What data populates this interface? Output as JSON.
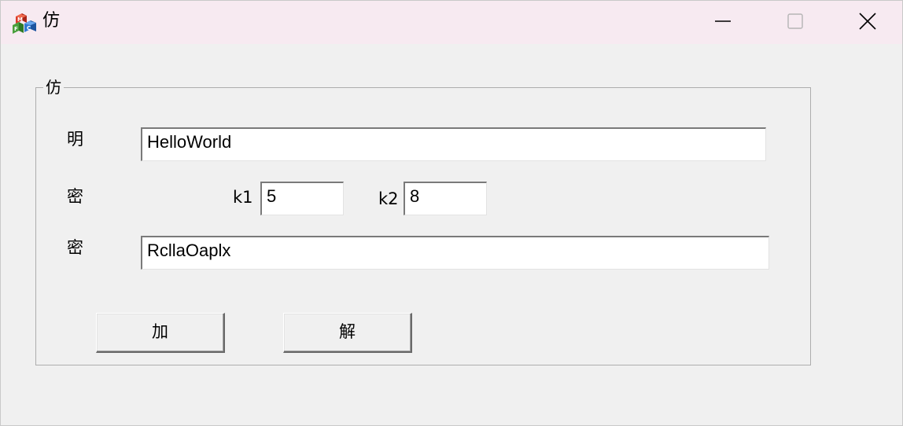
{
  "window": {
    "title": "仿",
    "app_icon": "mfc-app-icon",
    "controls": {
      "minimize_icon": "minimize-icon",
      "maximize_icon": "maximize-icon",
      "close_icon": "close-icon"
    }
  },
  "group": {
    "legend": "仿"
  },
  "form": {
    "plaintext_label": "明",
    "plaintext_value": "HelloWorld",
    "key_label": "密",
    "k1_label": "k1",
    "k1_value": "5",
    "k2_label": "k2",
    "k2_value": "8",
    "ciphertext_label": "密",
    "ciphertext_value": "RcllaOaplx"
  },
  "buttons": {
    "encrypt_label": "加",
    "decrypt_label": "解"
  },
  "colors": {
    "titlebar_bg": "#f7eaf1",
    "window_bg": "#f0f0f0"
  }
}
